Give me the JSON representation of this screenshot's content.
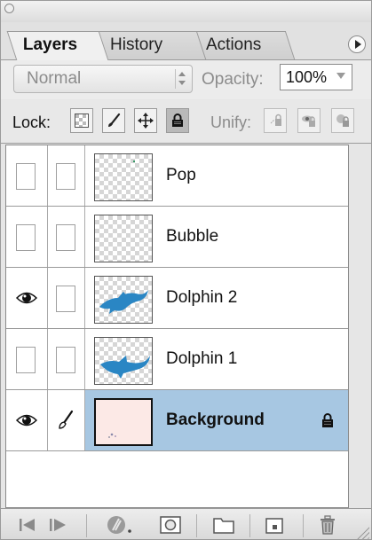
{
  "panel": {
    "tabs": [
      {
        "label": "Layers",
        "active": true
      },
      {
        "label": "History",
        "active": false
      },
      {
        "label": "Actions",
        "active": false
      }
    ]
  },
  "blend": {
    "mode": "Normal"
  },
  "opacity": {
    "label": "Opacity:",
    "value": "100%"
  },
  "lock": {
    "label": "Lock:",
    "active_button": "lock-all"
  },
  "unify": {
    "label": "Unify:"
  },
  "layers": [
    {
      "name": "Pop",
      "visible": false,
      "linked": false,
      "thumbnail": "transparent"
    },
    {
      "name": "Bubble",
      "visible": false,
      "linked": false,
      "thumbnail": "transparent"
    },
    {
      "name": "Dolphin 2",
      "visible": true,
      "linked": false,
      "thumbnail": "dolphin"
    },
    {
      "name": "Dolphin 1",
      "visible": false,
      "linked": false,
      "thumbnail": "dolphin"
    },
    {
      "name": "Background",
      "visible": true,
      "linked": true,
      "selected": true,
      "locked": true,
      "thumbnail": "background"
    }
  ],
  "colors": {
    "selection": "#a7c7e2",
    "dolphin": "#2a86c4"
  },
  "icons": [
    "eye-icon",
    "brush-icon",
    "lock-icon",
    "move-icon",
    "transparency-icon",
    "trash-icon",
    "new-layer-icon",
    "folder-icon",
    "mask-icon",
    "layer-style-icon",
    "prev-icon",
    "next-icon"
  ]
}
